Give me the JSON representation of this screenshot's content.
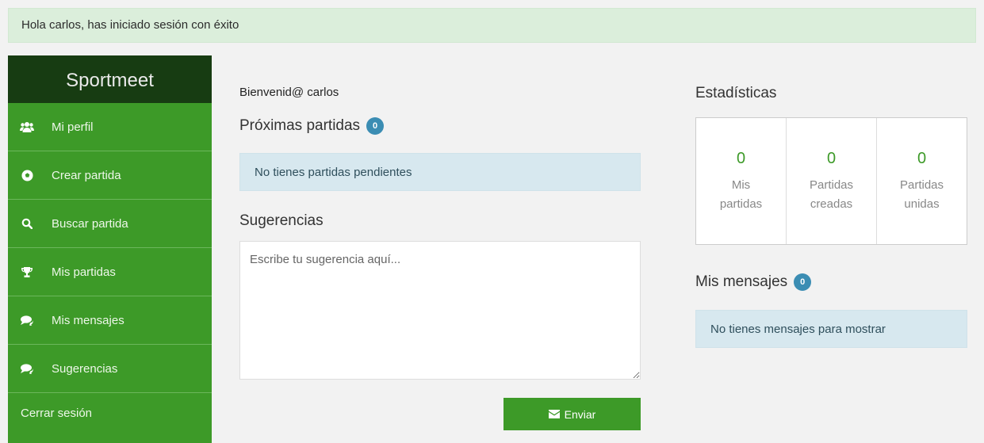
{
  "alert": "Hola carlos, has iniciado sesión con éxito",
  "sidebar": {
    "brand": "Sportmeet",
    "items": [
      {
        "label": "Mi perfil",
        "icon": "users-icon"
      },
      {
        "label": "Crear partida",
        "icon": "soccer-ball-icon"
      },
      {
        "label": "Buscar partida",
        "icon": "search-icon"
      },
      {
        "label": "Mis partidas",
        "icon": "trophy-icon"
      },
      {
        "label": "Mis mensajes",
        "icon": "chat-icon"
      },
      {
        "label": "Sugerencias",
        "icon": "chat-icon"
      }
    ],
    "logout": "Cerrar sesión"
  },
  "main": {
    "welcome": "Bienvenid@ carlos",
    "upcoming_title": "Próximas partidas",
    "upcoming_count": "0",
    "upcoming_empty": "No tienes partidas pendientes",
    "suggestions_title": "Sugerencias",
    "suggestions_placeholder": "Escribe tu sugerencia aquí...",
    "send_label": "Enviar"
  },
  "stats": {
    "title": "Estadísticas",
    "cells": [
      {
        "value": "0",
        "label": "Mis partidas"
      },
      {
        "value": "0",
        "label": "Partidas creadas"
      },
      {
        "value": "0",
        "label": "Partidas unidas"
      }
    ]
  },
  "messages": {
    "title": "Mis mensajes",
    "count": "0",
    "empty": "No tienes mensajes para mostrar"
  },
  "colors": {
    "sidebar_green": "#3d9a28",
    "sidebar_dark": "#173c12",
    "badge_blue": "#3b8db3",
    "alert_bg": "#dbeedb",
    "info_bg": "#d7e8ef"
  }
}
